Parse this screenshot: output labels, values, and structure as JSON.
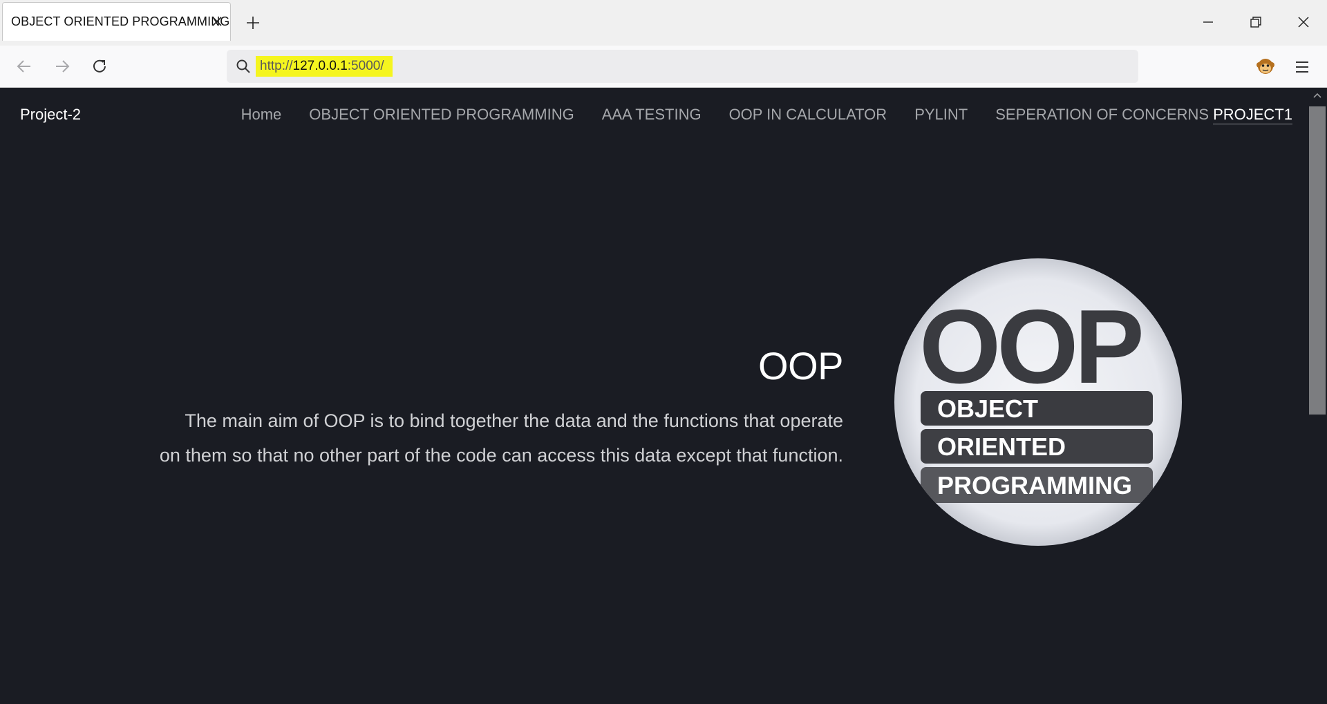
{
  "browser": {
    "tab_title": "OBJECT ORIENTED PROGRAMMING",
    "url_scheme": "http://",
    "url_host": "127.0.0.1",
    "url_rest": ":5000/"
  },
  "nav": {
    "brand": "Project-2",
    "links": [
      "Home",
      "OBJECT ORIENTED PROGRAMMING",
      "AAA TESTING",
      "OOP IN CALCULATOR",
      "PYLINT",
      "SEPERATION OF CONCERNS",
      "PROJECT1"
    ]
  },
  "hero": {
    "title": "OOP",
    "description_line1": "The main aim of OOP is to bind together the data and the functions that operate",
    "description_line2": "on them so that no other part of the code can access this data except that function."
  },
  "logo": {
    "big_text": "OOP",
    "line1": "OBJECT",
    "line2": "ORIENTED",
    "line3": "PROGRAMMING"
  },
  "colors": {
    "page_bg": "#1a1c23",
    "url_highlight": "#f5f51f",
    "logo_dark": "#3a3b40",
    "logo_light": "#eceef2"
  }
}
